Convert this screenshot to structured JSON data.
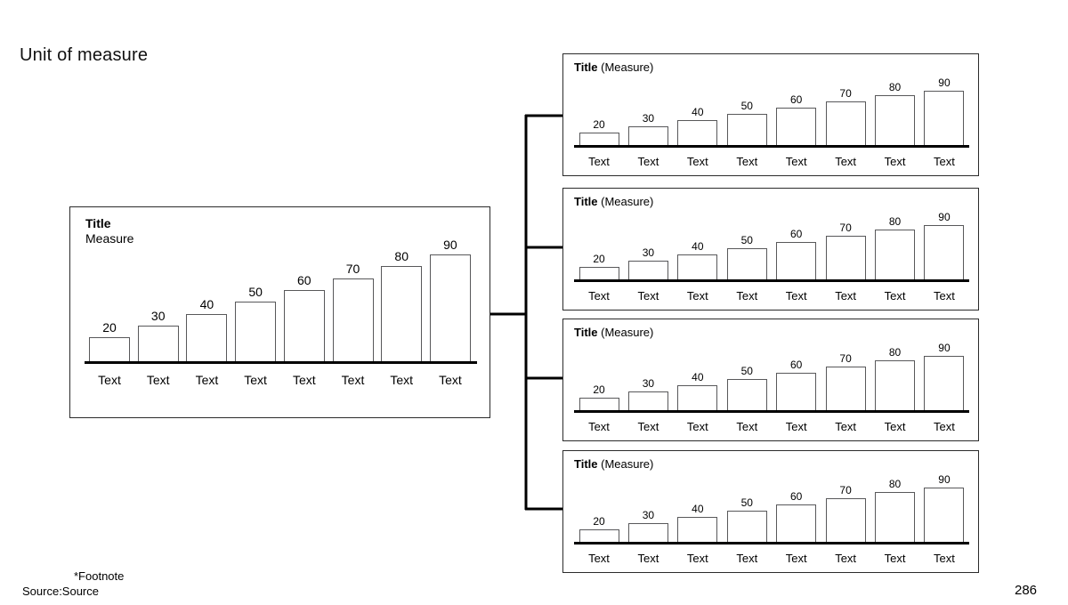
{
  "slide": {
    "heading": "Unit of measure",
    "footnote": "*Footnote",
    "source": "Source:Source",
    "page_number": "286"
  },
  "colors": {
    "bar_outline": "#58585a",
    "baseline": "#000000",
    "panel_border": "#2b2b2b",
    "text": "#000000",
    "background": "#ffffff"
  },
  "main_chart": {
    "title": "Title",
    "subtitle": "Measure"
  },
  "sub_panels": [
    {
      "title": "Title",
      "measure": "(Measure)"
    },
    {
      "title": "Title",
      "measure": "(Measure)"
    },
    {
      "title": "Title",
      "measure": "(Measure)"
    },
    {
      "title": "Title",
      "measure": "(Measure)"
    }
  ],
  "chart_data": [
    {
      "type": "bar",
      "title": "Title",
      "subtitle": "Measure",
      "xlabel": "",
      "ylabel": "Measure",
      "categories": [
        "Text",
        "Text",
        "Text",
        "Text",
        "Text",
        "Text",
        "Text",
        "Text"
      ],
      "values": [
        20,
        30,
        40,
        50,
        60,
        70,
        80,
        90
      ],
      "value_labels": [
        "20",
        "30",
        "40",
        "50",
        "60",
        "70",
        "80",
        "90"
      ],
      "ylim": [
        0,
        100
      ],
      "grid": false,
      "legend": false
    },
    {
      "type": "bar",
      "title": "Title",
      "subtitle": "(Measure)",
      "xlabel": "",
      "ylabel": "(Measure)",
      "categories": [
        "Text",
        "Text",
        "Text",
        "Text",
        "Text",
        "Text",
        "Text",
        "Text"
      ],
      "values": [
        20,
        30,
        40,
        50,
        60,
        70,
        80,
        90
      ],
      "value_labels": [
        "20",
        "30",
        "40",
        "50",
        "60",
        "70",
        "80",
        "90"
      ],
      "ylim": [
        0,
        100
      ],
      "grid": false,
      "legend": false
    },
    {
      "type": "bar",
      "title": "Title",
      "subtitle": "(Measure)",
      "xlabel": "",
      "ylabel": "(Measure)",
      "categories": [
        "Text",
        "Text",
        "Text",
        "Text",
        "Text",
        "Text",
        "Text",
        "Text"
      ],
      "values": [
        20,
        30,
        40,
        50,
        60,
        70,
        80,
        90
      ],
      "value_labels": [
        "20",
        "30",
        "40",
        "50",
        "60",
        "70",
        "80",
        "90"
      ],
      "ylim": [
        0,
        100
      ],
      "grid": false,
      "legend": false
    },
    {
      "type": "bar",
      "title": "Title",
      "subtitle": "(Measure)",
      "xlabel": "",
      "ylabel": "(Measure)",
      "categories": [
        "Text",
        "Text",
        "Text",
        "Text",
        "Text",
        "Text",
        "Text",
        "Text"
      ],
      "values": [
        20,
        30,
        40,
        50,
        60,
        70,
        80,
        90
      ],
      "value_labels": [
        "20",
        "30",
        "40",
        "50",
        "60",
        "70",
        "80",
        "90"
      ],
      "ylim": [
        0,
        100
      ],
      "grid": false,
      "legend": false
    },
    {
      "type": "bar",
      "title": "Title",
      "subtitle": "(Measure)",
      "xlabel": "",
      "ylabel": "(Measure)",
      "categories": [
        "Text",
        "Text",
        "Text",
        "Text",
        "Text",
        "Text",
        "Text",
        "Text"
      ],
      "values": [
        20,
        30,
        40,
        50,
        60,
        70,
        80,
        90
      ],
      "value_labels": [
        "20",
        "30",
        "40",
        "50",
        "60",
        "70",
        "80",
        "90"
      ],
      "ylim": [
        0,
        100
      ],
      "grid": false,
      "legend": false
    }
  ]
}
